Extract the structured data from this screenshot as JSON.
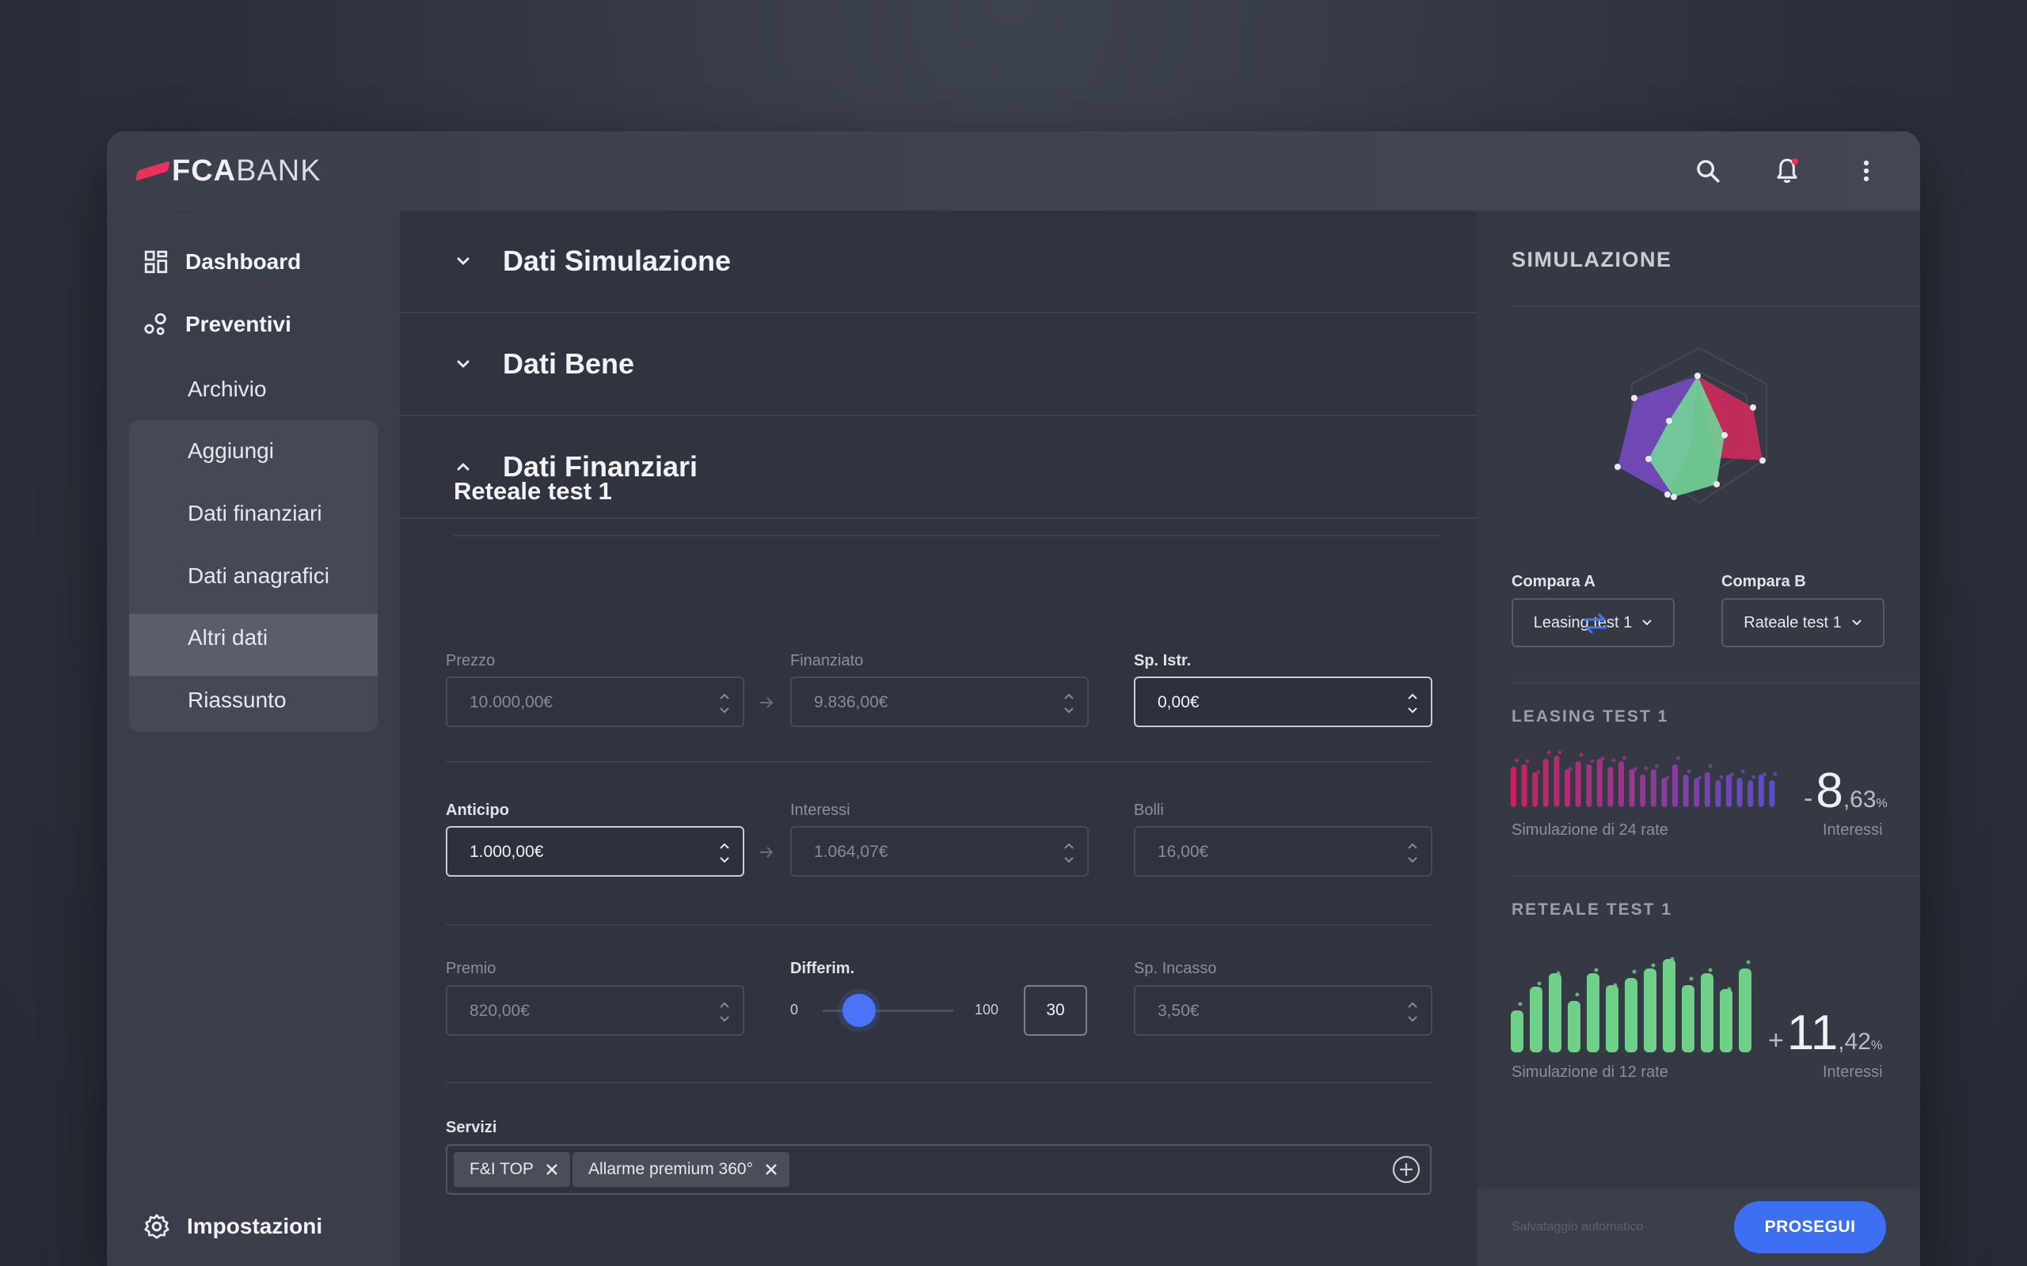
{
  "brand": {
    "bold": "FCA",
    "light": "BANK"
  },
  "topbar": {
    "icons": [
      "search-icon",
      "bell-icon",
      "more-vertical-icon"
    ]
  },
  "colors": {
    "accent": "#3d6ff2",
    "brand": "#e8315b",
    "bars_leasing": "#c7245e",
    "bars_reteale": "#6fd08a"
  },
  "sidebar": {
    "dashboard": "Dashboard",
    "preventivi": "Preventivi",
    "subitems": [
      "Archivio",
      "Aggiungi",
      "Dati finanziari",
      "Dati anagrafici",
      "Altri dati",
      "Riassunto"
    ],
    "active": "Dati finanziari",
    "settings": "Impostazioni"
  },
  "main": {
    "sections": [
      "Dati Simulazione",
      "Dati Bene",
      "Dati Finanziari"
    ],
    "card_title": "Reteale test 1",
    "fields": {
      "prezzo": {
        "label": "Prezzo",
        "value": "10.000,00€"
      },
      "finanziato": {
        "label": "Finanziato",
        "value": "9.836,00€"
      },
      "sp_istr": {
        "label": "Sp. Istr.",
        "value": "0,00€"
      },
      "anticipo": {
        "label": "Anticipo",
        "value": "1.000,00€"
      },
      "interessi": {
        "label": "Interessi",
        "value": "1.064,07€"
      },
      "bolli": {
        "label": "Bolli",
        "value": "16,00€"
      },
      "premio": {
        "label": "Premio",
        "value": "820,00€"
      },
      "differim": {
        "label": "Differim.",
        "min": "0",
        "max": "100",
        "value": "30"
      },
      "sp_incasso": {
        "label": "Sp. Incasso",
        "value": "3,50€"
      }
    },
    "servizi": {
      "label": "Servizi",
      "chips": [
        "F&I TOP",
        "Allarme premium 360°"
      ]
    }
  },
  "simulazione": {
    "title": "SIMULAZIONE",
    "compara_a": {
      "label": "Compara A",
      "value": "Leasing test 1"
    },
    "compara_b": {
      "label": "Compara B",
      "value": "Rateale test 1"
    },
    "leasing": {
      "title": "LEASING TEST 1",
      "note": "Simulazione di 24 rate",
      "sign": "-",
      "int": "8",
      "dec": ",63",
      "pct": "%",
      "caption": "Interessi",
      "bars": [
        0.75,
        0.8,
        0.65,
        0.9,
        0.95,
        0.7,
        0.85,
        0.8,
        0.9,
        0.75,
        0.85,
        0.7,
        0.6,
        0.7,
        0.55,
        0.8,
        0.6,
        0.55,
        0.65,
        0.5,
        0.6,
        0.55,
        0.5,
        0.6,
        0.5
      ]
    },
    "reteale": {
      "title": "RETEALE TEST 1",
      "note": "Simulazione di 12 rate",
      "sign": "+",
      "int": "11",
      "dec": ",42",
      "pct": "%",
      "caption": "Interessi",
      "bars": [
        0.45,
        0.7,
        0.85,
        0.55,
        0.85,
        0.72,
        0.8,
        0.9,
        1.0,
        0.72,
        0.85,
        0.68,
        0.9
      ]
    }
  },
  "footer": {
    "autosave": "Salvataggio automatico",
    "proceed": "PROSEGUI"
  }
}
